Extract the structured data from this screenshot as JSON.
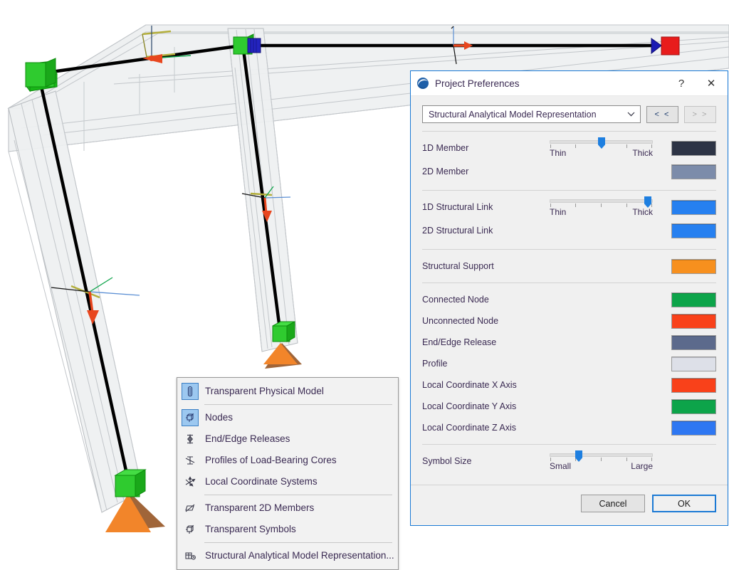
{
  "dialog": {
    "title": "Project Preferences",
    "logo_icon": "archicad-sphere-icon",
    "help_label": "?",
    "close_label": "✕",
    "selector": {
      "value": "Structural Analytical Model Representation",
      "arrow_icon": "chevron-down-icon",
      "prev_label": "< <",
      "next_label": "> >"
    },
    "sections": [
      {
        "rows": [
          {
            "label": "1D Member",
            "color": "#2d3445",
            "slider": {
              "value": 50,
              "min_label": "Thin",
              "max_label": "Thick",
              "ticks": 5
            }
          },
          {
            "label": "2D Member",
            "color": "#7c8caa"
          }
        ]
      },
      {
        "rows": [
          {
            "label": "1D Structural Link",
            "color": "#2680f0",
            "slider": {
              "value": 95,
              "min_label": "Thin",
              "max_label": "Thick",
              "ticks": 5
            }
          },
          {
            "label": "2D Structural Link",
            "color": "#2680f0"
          }
        ]
      },
      {
        "rows": [
          {
            "label": "Structural Support",
            "color": "#f7901e"
          }
        ]
      },
      {
        "rows": [
          {
            "label": "Connected Node",
            "color": "#0da44a"
          },
          {
            "label": "Unconnected Node",
            "color": "#f9411a"
          },
          {
            "label": "End/Edge Release",
            "color": "#5c6a8c"
          },
          {
            "label": "Profile",
            "color": "#dde0e8"
          },
          {
            "label": "Local Coordinate X Axis",
            "color": "#f9411a"
          },
          {
            "label": "Local Coordinate Y Axis",
            "color": "#0da44a"
          },
          {
            "label": "Local Coordinate Z Axis",
            "color": "#2e77f2"
          }
        ]
      },
      {
        "rows": [
          {
            "label": "Symbol Size",
            "slider": {
              "value": 28,
              "min_label": "Small",
              "max_label": "Large",
              "ticks": 5
            }
          }
        ]
      }
    ],
    "footer": {
      "cancel_label": "Cancel",
      "ok_label": "OK"
    }
  },
  "context_menu": {
    "items": [
      {
        "label": "Transparent Physical Model",
        "icon": "transparent-physical-model-icon",
        "selected": true,
        "separator_after": true
      },
      {
        "label": "Nodes",
        "icon": "nodes-icon",
        "selected": true,
        "separator_after": false
      },
      {
        "label": "End/Edge Releases",
        "icon": "end-edge-releases-icon",
        "selected": false,
        "separator_after": false
      },
      {
        "label": "Profiles of Load-Bearing Cores",
        "icon": "profiles-load-bearing-cores-icon",
        "selected": false,
        "separator_after": false
      },
      {
        "label": "Local Coordinate Systems",
        "icon": "local-coordinate-systems-icon",
        "selected": false,
        "separator_after": true
      },
      {
        "label": "Transparent 2D Members",
        "icon": "transparent-2d-members-icon",
        "selected": false,
        "separator_after": false
      },
      {
        "label": "Transparent Symbols",
        "icon": "transparent-symbols-icon",
        "selected": false,
        "separator_after": true
      },
      {
        "label": "Structural Analytical Model Representation...",
        "icon": "structural-analytical-model-representation-icon",
        "selected": false,
        "separator_after": false
      }
    ]
  },
  "viewport": {
    "name": "structural-analytical-model-3d-view",
    "colors": {
      "connected_node": "#22c522",
      "unconnected_node": "#e01b1b",
      "end_edge_release": "#1a1ab4",
      "support": "#f2852a",
      "support_shadow": "#8f4a16",
      "member_line": "#000000",
      "x_axis": "#e8461e",
      "y_axis": "#0da44a",
      "z_axis": "#5b8fd4",
      "profile": "#b3ae3a",
      "physical_ghost": "#eceef0"
    }
  }
}
